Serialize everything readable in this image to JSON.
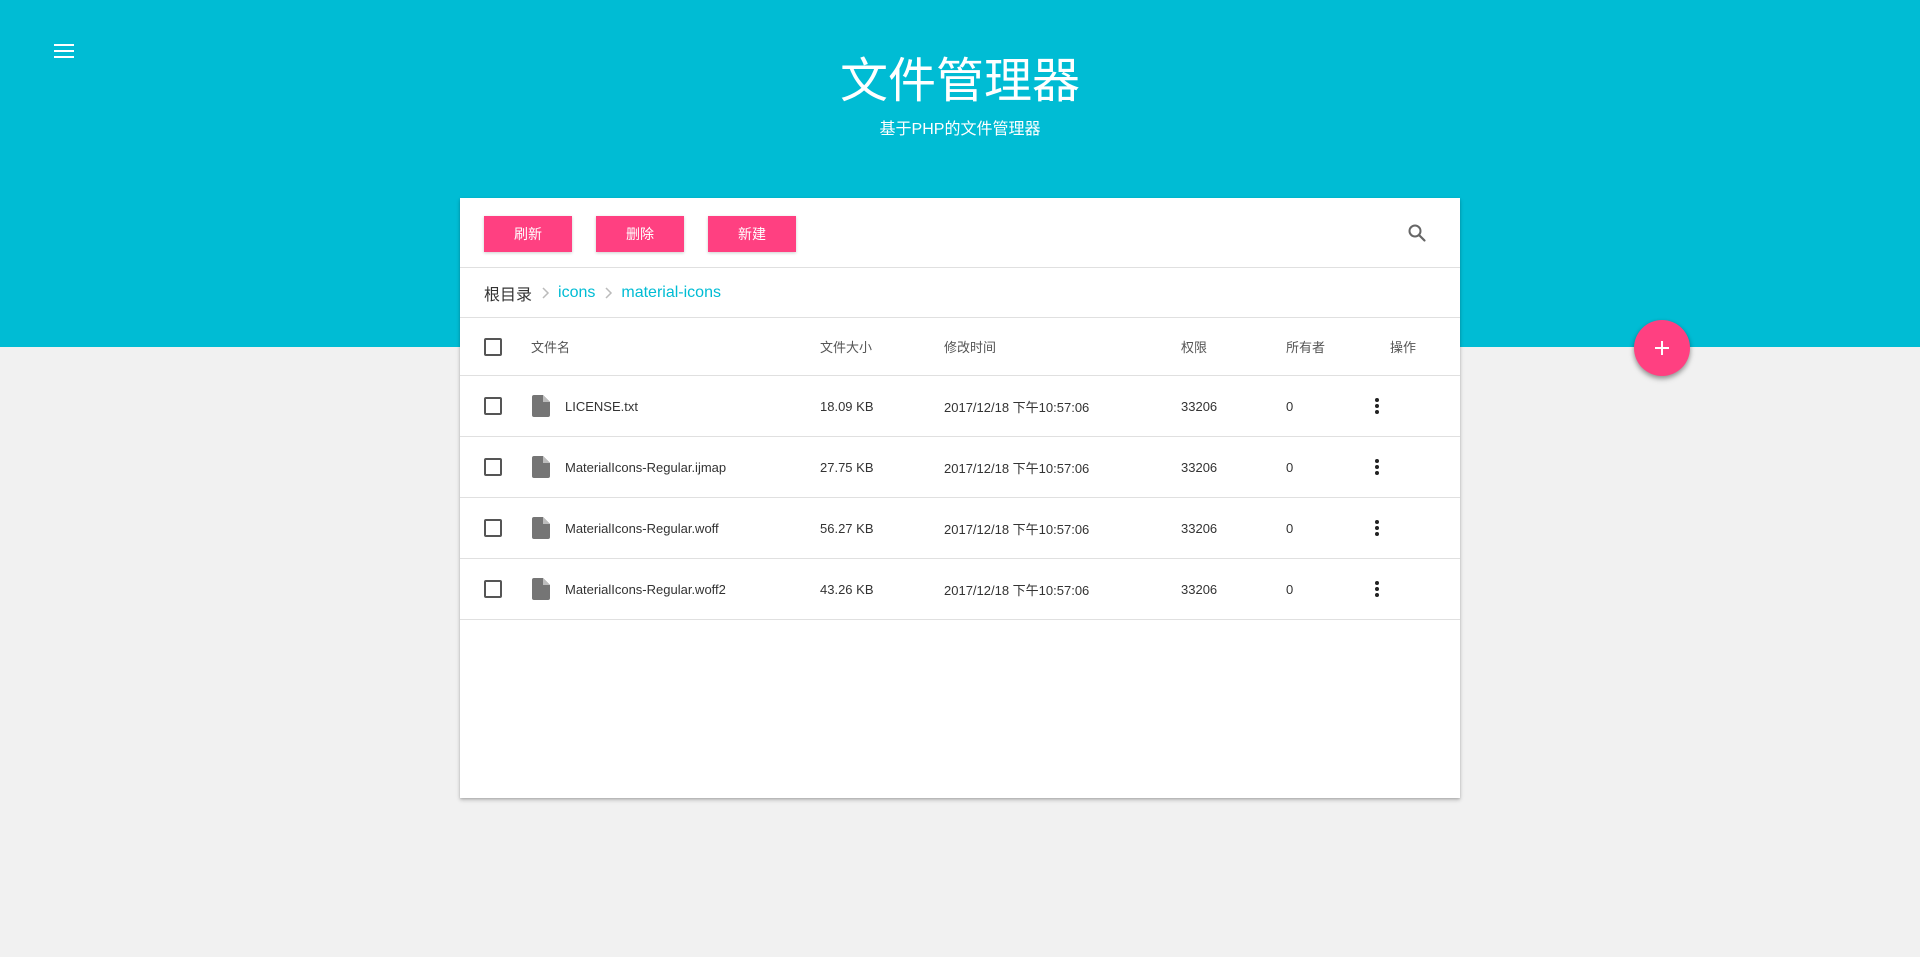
{
  "app": {
    "title": "文件管理器",
    "subtitle": "基于PHP的文件管理器"
  },
  "colors": {
    "header": "#00bcd4",
    "accent": "#ff4081",
    "background": "#f1f1f1"
  },
  "toolbar": {
    "refresh_label": "刷新",
    "delete_label": "删除",
    "new_label": "新建",
    "search_icon": "search-icon"
  },
  "breadcrumb": [
    {
      "label": "根目录"
    },
    {
      "label": "icons"
    },
    {
      "label": "material-icons"
    }
  ],
  "table": {
    "columns": [
      "文件名",
      "文件大小",
      "修改时间",
      "权限",
      "所有者",
      "操作"
    ],
    "rows": [
      {
        "name": "LICENSE.txt",
        "size": "18.09 KB",
        "modified": "2017/12/18 下午10:57:06",
        "perm": "33206",
        "owner": "0"
      },
      {
        "name": "MaterialIcons-Regular.ijmap",
        "size": "27.75 KB",
        "modified": "2017/12/18 下午10:57:06",
        "perm": "33206",
        "owner": "0"
      },
      {
        "name": "MaterialIcons-Regular.woff",
        "size": "56.27 KB",
        "modified": "2017/12/18 下午10:57:06",
        "perm": "33206",
        "owner": "0"
      },
      {
        "name": "MaterialIcons-Regular.woff2",
        "size": "43.26 KB",
        "modified": "2017/12/18 下午10:57:06",
        "perm": "33206",
        "owner": "0"
      }
    ]
  },
  "fab": {
    "icon": "plus-icon"
  }
}
